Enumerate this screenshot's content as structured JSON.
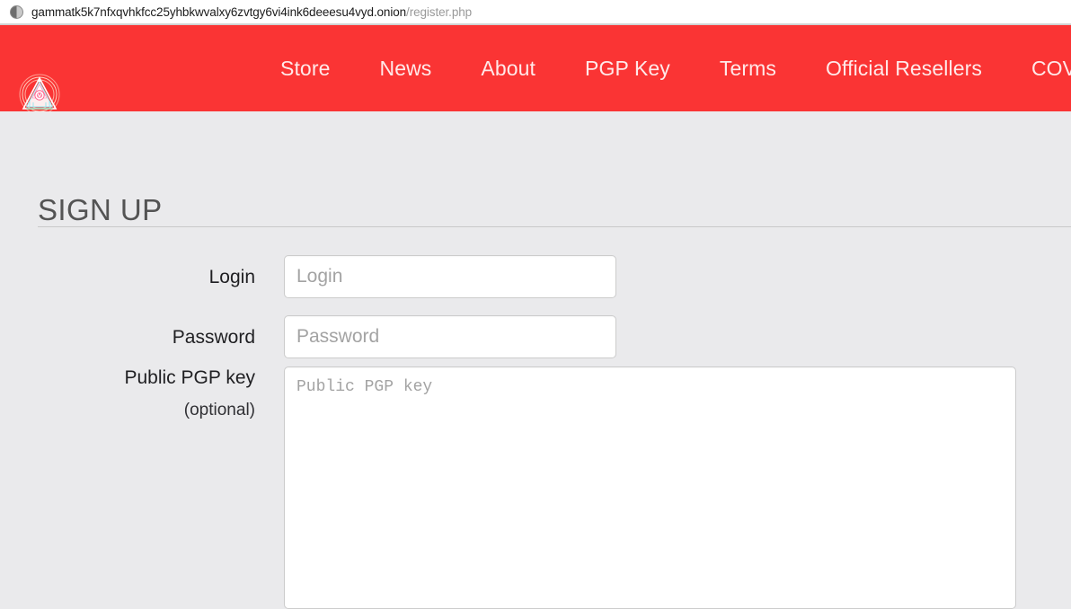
{
  "browser": {
    "identity_icon": "onion-site-identity-icon",
    "url_host": "gammatk5k7nfxqvhkfcc25yhbkwvalxy6zvtgy6vi4ink6deeesu4vyd.onion",
    "url_path": "/register.php"
  },
  "header": {
    "background_color": "#fa3434",
    "logo_icon": "pyramid-emblem-logo",
    "nav": [
      {
        "label": "Store"
      },
      {
        "label": "News"
      },
      {
        "label": "About"
      },
      {
        "label": "PGP Key"
      },
      {
        "label": "Terms"
      },
      {
        "label": "Official Resellers"
      },
      {
        "label": "COVID Shipping Res"
      }
    ]
  },
  "page": {
    "title": "SIGN UP",
    "background_color": "#eaeaec",
    "title_color": "#545454"
  },
  "form": {
    "fields": [
      {
        "label": "Login",
        "sublabel": "",
        "placeholder": "Login",
        "value": "",
        "type": "text"
      },
      {
        "label": "Password",
        "sublabel": "",
        "placeholder": "Password",
        "value": "",
        "type": "password"
      },
      {
        "label": "Public PGP key",
        "sublabel": "(optional)",
        "placeholder": "Public PGP key",
        "value": "",
        "type": "textarea"
      }
    ]
  }
}
